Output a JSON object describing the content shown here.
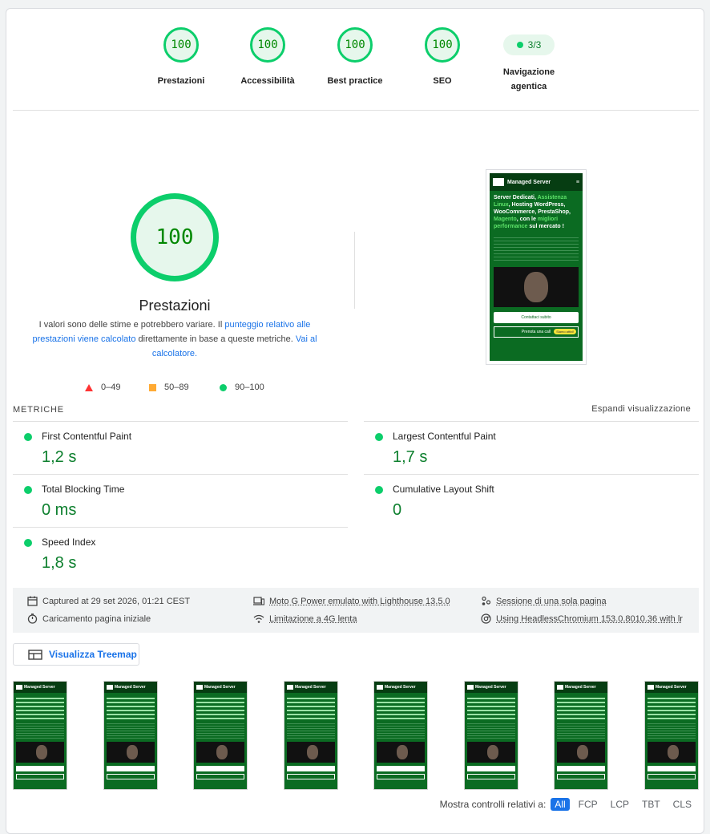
{
  "categories": [
    {
      "name": "gauge-prestazioni",
      "score": "100",
      "label": "Prestazioni"
    },
    {
      "name": "gauge-accessibilita",
      "score": "100",
      "label": "Accessibilità"
    },
    {
      "name": "gauge-best-practice",
      "score": "100",
      "label": "Best practice"
    },
    {
      "name": "gauge-seo",
      "score": "100",
      "label": "SEO"
    }
  ],
  "agentic": {
    "pill": "3/3",
    "label_line1": "Navigazione",
    "label_line2": "agentica"
  },
  "performance": {
    "score": "100",
    "title": "Prestazioni",
    "note_pre": "I valori sono delle stime e potrebbero variare. Il ",
    "note_link1": "punteggio relativo alle prestazioni viene calcolato",
    "note_mid": " direttamente in base a queste metriche. ",
    "note_link2": "Vai al calcolatore.",
    "legend": {
      "fail": "0–49",
      "average": "50–89",
      "pass": "90–100"
    }
  },
  "screenshot": {
    "brand": "Managed Server",
    "headline_1": "Server Dedicati, ",
    "headline_hl1": "Assistenza Linux",
    "headline_2": ", Hosting WordPress, WooCommerce, PrestaShop, ",
    "headline_hl2": "Magento",
    "headline_3": ", con le ",
    "headline_hl3": "migliori performance",
    "headline_4": " sul mercato !",
    "btn_contact": "Contattaci subito",
    "btn_book": "Prenota una call",
    "badge": "Siamo attivi!"
  },
  "metrics": {
    "title": "METRICHE",
    "expand": "Espandi visualizzazione",
    "fcp": {
      "name": "First Contentful Paint",
      "value": "1,2 s"
    },
    "lcp": {
      "name": "Largest Contentful Paint",
      "value": "1,7 s"
    },
    "tbt": {
      "name": "Total Blocking Time",
      "value": "0 ms"
    },
    "cls": {
      "name": "Cumulative Layout Shift",
      "value": "0"
    },
    "si": {
      "name": "Speed Index",
      "value": "1,8 s"
    }
  },
  "info": {
    "captured": "Captured at 29 set 2026, 01:21 CEST",
    "load": "Caricamento pagina iniziale",
    "device": "Moto G Power emulato with Lighthouse 13.5.0",
    "throttle": "Limitazione a 4G lenta",
    "session": "Sessione di una sola pagina",
    "browser": "Using HeadlessChromium 153.0.8010.36 with lr"
  },
  "treemap": {
    "label": "Visualizza Treemap"
  },
  "controls": {
    "label": "Mostra controlli relativi a:",
    "options": [
      "All",
      "FCP",
      "LCP",
      "TBT",
      "CLS"
    ]
  },
  "colors": {
    "pass": "#0cce6b",
    "pass_text": "#0c7f2d",
    "average": "#ffaa33",
    "fail": "#ff3333",
    "link": "#1a73e8"
  }
}
